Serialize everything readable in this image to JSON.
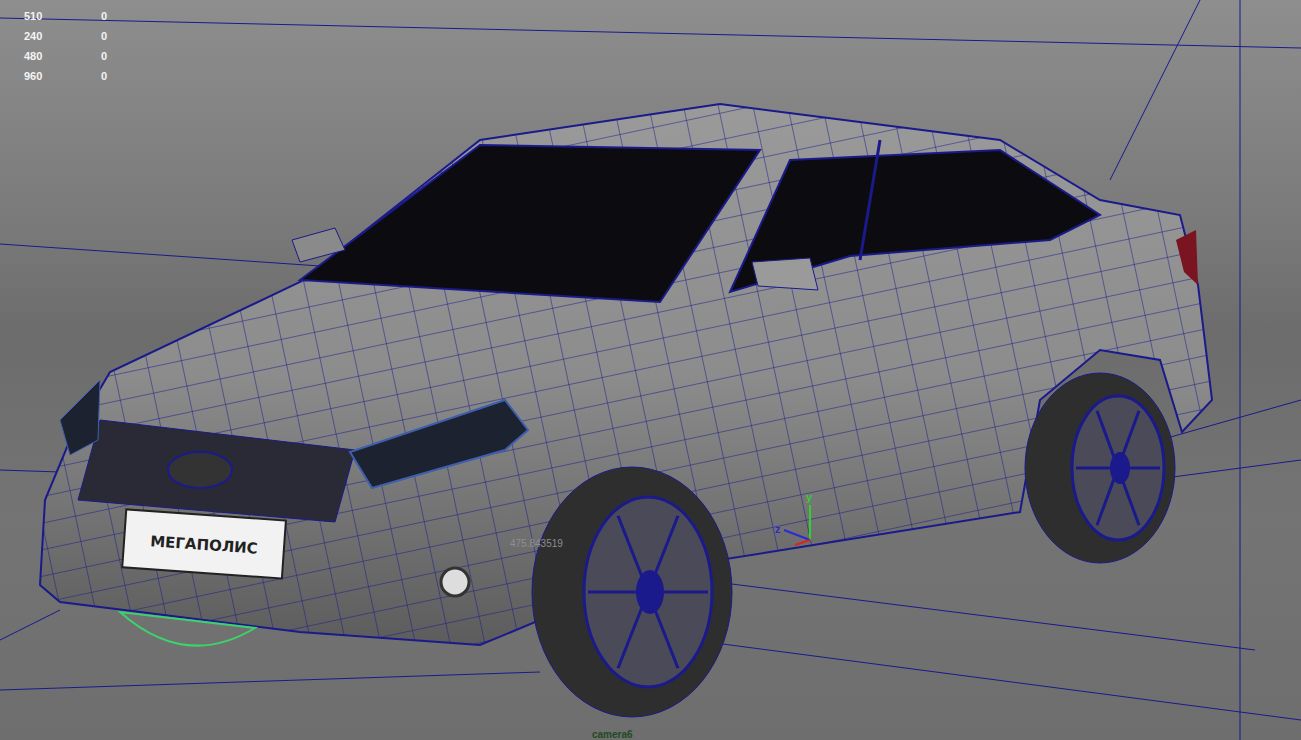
{
  "viewport": {
    "camera": "camera6",
    "hud": [
      {
        "label": "510",
        "value": "0"
      },
      {
        "label": "240",
        "value": "0"
      },
      {
        "label": "480",
        "value": "0"
      },
      {
        "label": "960",
        "value": "0"
      }
    ],
    "annotation": "475.843519",
    "plate": "МЕГАПОЛИС",
    "axes": [
      {
        "label": "y",
        "color": "#2fd12f"
      },
      {
        "label": "z",
        "color": "#2a2ad8"
      }
    ]
  }
}
